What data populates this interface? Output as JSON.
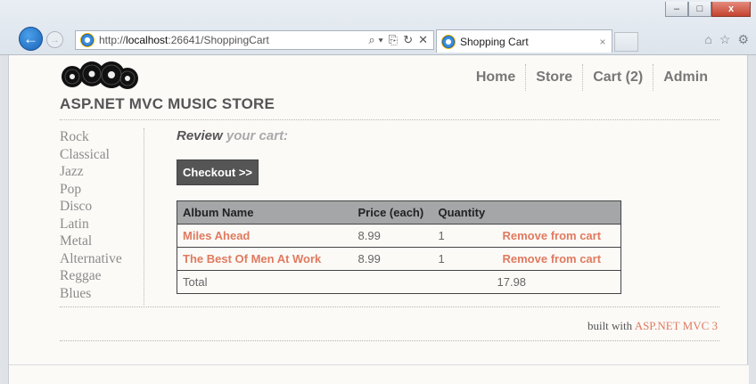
{
  "browser": {
    "address_prefix": "http://",
    "address_host": "localhost",
    "address_rest": ":26641/ShoppingCart",
    "tab_title": "Shopping Cart",
    "minimize": "–",
    "maximize": "□",
    "close": "x",
    "search_glyph": "⌕ ▾",
    "compat_glyph": "⎘",
    "refresh_glyph": "↻",
    "stop_glyph": "✕",
    "tab_close": "×",
    "home_glyph": "⌂",
    "star_glyph": "☆",
    "gear_glyph": "⚙",
    "back_glyph": "←",
    "forward_glyph": "→"
  },
  "site": {
    "title": "ASP.NET MVC MUSIC STORE",
    "nav": [
      "Home",
      "Store",
      "Cart (2)",
      "Admin"
    ]
  },
  "genres": [
    "Rock",
    "Classical",
    "Jazz",
    "Pop",
    "Disco",
    "Latin",
    "Metal",
    "Alternative",
    "Reggae",
    "Blues"
  ],
  "cart": {
    "heading_strong": "Review",
    "heading_rest": " your cart:",
    "checkout_label": "Checkout >>",
    "columns": [
      "Album Name",
      "Price (each)",
      "Quantity",
      ""
    ],
    "rows": [
      {
        "album": "Miles Ahead",
        "price": "8.99",
        "quantity": "1",
        "action": "Remove from cart"
      },
      {
        "album": "The Best Of Men At Work",
        "price": "8.99",
        "quantity": "1",
        "action": "Remove from cart"
      }
    ],
    "total_label": "Total",
    "total_value": "17.98"
  },
  "footer": {
    "prefix": "built with ",
    "brand": "ASP.NET MVC 3"
  },
  "colors": {
    "accent": "#e07a5f",
    "header_bg": "#a4a6a8",
    "button_bg": "#555555"
  }
}
